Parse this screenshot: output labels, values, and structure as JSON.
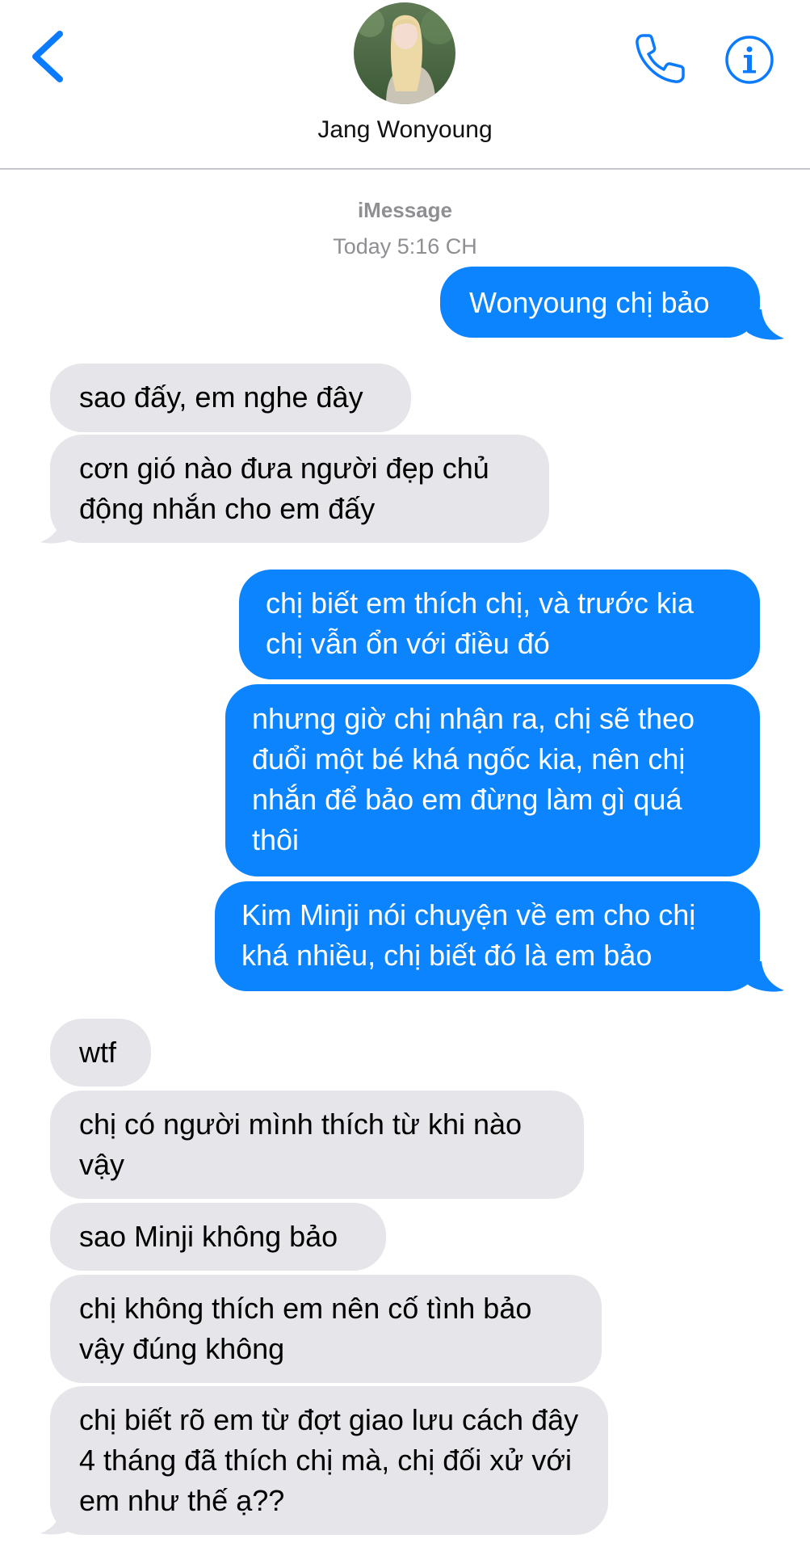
{
  "header": {
    "contact_name": "Jang Wonyoung"
  },
  "thread": {
    "service": "iMessage",
    "timestamp": "Today 5:16 CH"
  },
  "messages": [
    {
      "direction": "sent",
      "text": "Wonyoung chị bảo"
    },
    {
      "direction": "received",
      "text": "sao đấy, em nghe đây"
    },
    {
      "direction": "received",
      "text": "cơn gió nào đưa người đẹp chủ động nhắn cho em đấy"
    },
    {
      "direction": "sent",
      "text": "chị biết em thích chị, và trước kia chị vẫn ổn với điều đó"
    },
    {
      "direction": "sent",
      "text": "nhưng giờ chị nhận ra, chị sẽ theo đuổi một bé khá ngốc kia, nên chị nhắn để bảo em đừng làm gì quá thôi"
    },
    {
      "direction": "sent",
      "text": "Kim Minji nói chuyện về em cho chị khá nhiều, chị biết đó là em bảo"
    },
    {
      "direction": "received",
      "text": "wtf"
    },
    {
      "direction": "received",
      "text": "chị có người mình thích từ khi nào vậy"
    },
    {
      "direction": "received",
      "text": "sao Minji không bảo"
    },
    {
      "direction": "received",
      "text": "chị không thích em nên cố tình bảo vậy đúng không"
    },
    {
      "direction": "received",
      "text": "chị biết rõ em từ đợt giao lưu cách đây 4 tháng đã thích chị mà, chị đối xử với em như thế ạ??"
    }
  ],
  "colors": {
    "sent_bubble": "#0b84fe",
    "received_bubble": "#e5e5ea",
    "ios_blue": "#0a7aff",
    "meta_gray": "#8e8e93"
  },
  "icons": [
    "chevron-left-icon",
    "phone-icon",
    "info-icon"
  ]
}
